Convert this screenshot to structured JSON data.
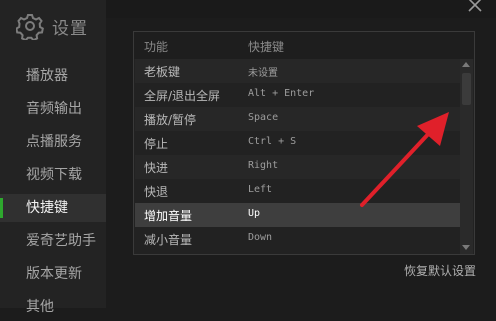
{
  "header": {
    "title": "设置",
    "icon": "gear-icon"
  },
  "sidebar": {
    "items": [
      {
        "label": "播放器"
      },
      {
        "label": "音频输出"
      },
      {
        "label": "点播服务"
      },
      {
        "label": "视频下载"
      },
      {
        "label": "快捷键"
      },
      {
        "label": "爱奇艺助手"
      },
      {
        "label": "版本更新"
      },
      {
        "label": "其他"
      }
    ],
    "active_index": 4
  },
  "shortcuts": {
    "columns": {
      "function": "功能",
      "key": "快捷键"
    },
    "rows": [
      {
        "function": "老板键",
        "key": "未设置"
      },
      {
        "function": "全屏/退出全屏",
        "key": "Alt + Enter"
      },
      {
        "function": "播放/暂停",
        "key": "Space"
      },
      {
        "function": "停止",
        "key": "Ctrl + S"
      },
      {
        "function": "快进",
        "key": "Right"
      },
      {
        "function": "快退",
        "key": "Left"
      },
      {
        "function": "增加音量",
        "key": "Up"
      },
      {
        "function": "减小音量",
        "key": "Down"
      }
    ],
    "selected_index": 6
  },
  "restore_defaults_label": "恢复默认设置",
  "colors": {
    "accent": "#2ea82e",
    "arrow": "#e0202a"
  }
}
